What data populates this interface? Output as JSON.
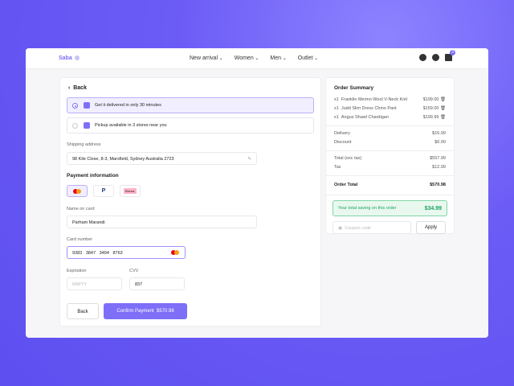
{
  "header": {
    "logo": "Saba",
    "nav": [
      "New arrival",
      "Women",
      "Men",
      "Outlet"
    ],
    "cart_count": "3"
  },
  "checkout": {
    "back": "Back",
    "delivery_option": "Get it delivered in only 30 minutes",
    "pickup_option": "Pickup available in 3 stores near you",
    "shipping_label": "Shipping address",
    "shipping_value": "98 Kile Close, 8-3, Marsfield, Sydney Australia 2723",
    "payment_title": "Payment information",
    "methods": [
      "Mastercard",
      "PayPal",
      "Klarna."
    ],
    "name_label": "Name on card",
    "name_value": "Parham Marandi",
    "card_label": "Card number",
    "card_value": "9383   3847   3494   8763",
    "exp_label": "Expiration",
    "exp_placeholder": "MM/YY",
    "cvv_label": "CVV",
    "cvv_value": "837",
    "back_button": "Back",
    "confirm_button": "Confirm Payment  $570.98"
  },
  "summary": {
    "title": "Order Summary",
    "items": [
      {
        "qty": "x1",
        "name": "Franklin Merino Wool V-Neck Knit",
        "price": "$199.00"
      },
      {
        "qty": "x1",
        "name": "Judd Slim Dress Chino Pant",
        "price": "$159.00"
      },
      {
        "qty": "x1",
        "name": "Angus Shawl Chardigan",
        "price": "$199.99"
      }
    ],
    "delivery_label": "Delivery",
    "delivery": "$16.99",
    "discount_label": "Discount",
    "discount": "$0.00",
    "subtotal_label": "Total (exc tax)",
    "subtotal": "$557.99",
    "tax_label": "Tax",
    "tax": "$12.99",
    "total_label": "Order Total",
    "total": "$570.98",
    "saving_label": "Your total saving on this order",
    "saving": "$34.99",
    "coupon_placeholder": "Coupon code",
    "apply": "Apply"
  },
  "colors": {
    "accent": "#7d6ff7",
    "success": "#1fa463"
  }
}
